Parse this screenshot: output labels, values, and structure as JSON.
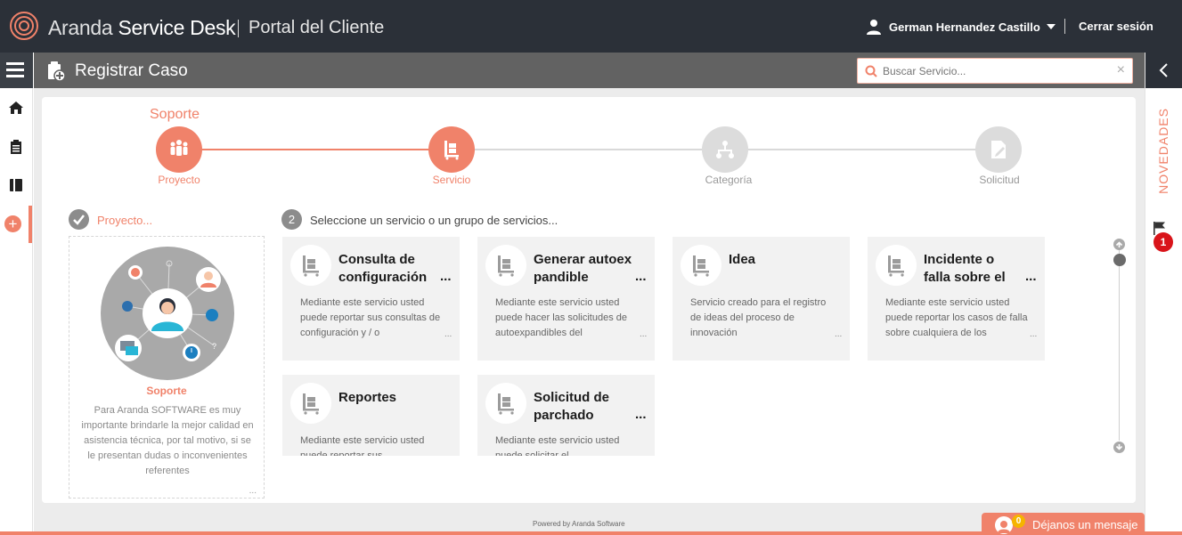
{
  "app": {
    "brand_light": "Aranda",
    "brand_bold": "Service Desk",
    "portal": "Portal del Cliente"
  },
  "user": {
    "name": "German Hernandez Castillo",
    "logout": "Cerrar sesión"
  },
  "page": {
    "title": "Registrar Caso",
    "search_placeholder": "Buscar Servicio..."
  },
  "right_panel": {
    "label": "NOVEDADES",
    "notifications": "1"
  },
  "wizard": {
    "project_title": "Soporte",
    "steps": [
      {
        "label": "Proyecto",
        "state": "done"
      },
      {
        "label": "Servicio",
        "state": "active"
      },
      {
        "label": "Categoría",
        "state": "pending"
      },
      {
        "label": "Solicitud",
        "state": "pending"
      }
    ]
  },
  "project_panel": {
    "header": "Proyecto...",
    "name": "Soporte",
    "description": "Para Aranda SOFTWARE es muy importante brindarle la mejor calidad en asistencia técnica, por tal motivo, si se le presentan dudas o inconvenientes referentes",
    "more": "..."
  },
  "services_panel": {
    "step_number": "2",
    "instruction": "Seleccione un servicio o un grupo de servicios..."
  },
  "services": [
    {
      "title": "Consulta de configuración",
      "desc": "Mediante este servicio usted puede reportar sus consultas de configuración y / o",
      "dots": "...",
      "more": "..."
    },
    {
      "title": "Generar autoexpandible",
      "desc": "Mediante este servicio usted puede hacer las solicitudes de autoexpandibles del",
      "dots": "...",
      "more": "..."
    },
    {
      "title": "Idea",
      "desc": "Servicio creado para el registro de ideas del proceso de innovación",
      "dots": "",
      "more": "..."
    },
    {
      "title": "Incidente o falla sobre el",
      "desc": "Mediante este servicio usted puede reportar los casos de falla sobre cualquiera de los",
      "dots": "...",
      "more": "..."
    },
    {
      "title": "Reportes",
      "desc": "Mediante este servicio usted puede reportar sus",
      "dots": "",
      "more": ""
    },
    {
      "title": "Solicitud de parchado",
      "desc": "Mediante este servicio usted puede solicitar el",
      "dots": "...",
      "more": ""
    }
  ],
  "footer": {
    "powered": "Powered by Aranda Software"
  },
  "chat": {
    "count": "0",
    "label": "Déjanos un mensaje"
  },
  "colors": {
    "accent": "#f0826a",
    "topbar": "#2b3038",
    "titlebar": "#626262",
    "inactive": "#d9d9d9"
  }
}
